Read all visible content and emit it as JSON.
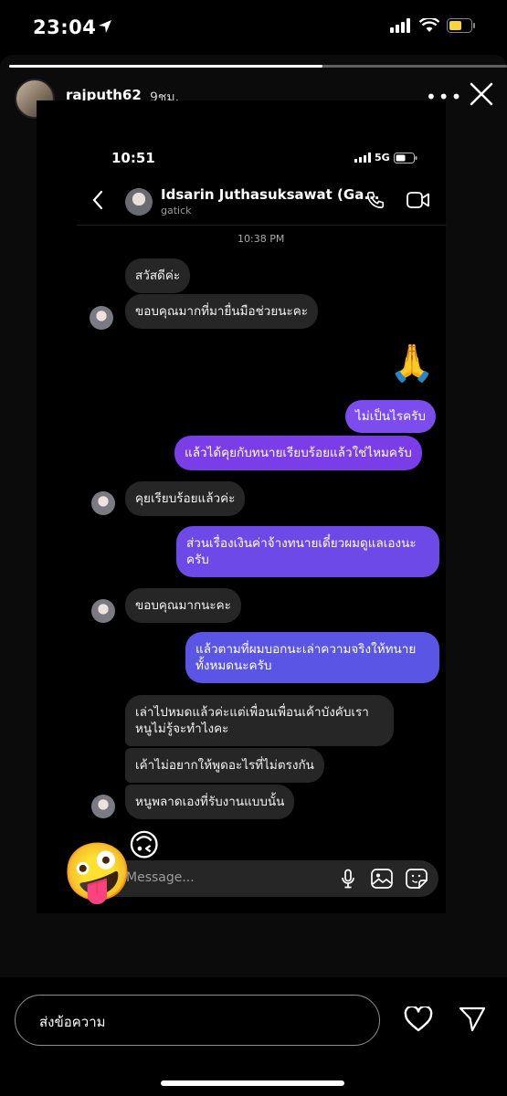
{
  "status_bar": {
    "time": "23:04"
  },
  "story": {
    "progress": 0.63,
    "username": "rajputh62",
    "time_ago": "9ชม."
  },
  "embedded": {
    "time": "10:51",
    "network": "5G",
    "chat_name": "Idsarin Juthasuksawat (Ga...",
    "chat_handle": "gatick",
    "date_label": "10:38 PM",
    "messages": [
      {
        "text": "สวัสดีค่ะ",
        "side": "received"
      },
      {
        "text": "ขอบคุณมากที่มายื่นมือช่วยนะคะ",
        "side": "received"
      },
      {
        "text": "🙏",
        "side": "sent"
      },
      {
        "text": "ไม่เป็นไรครับ",
        "side": "sent"
      },
      {
        "text": "แล้วได้คุยกับทนายเรียบร้อยแล้วใช่ไหมครับ",
        "side": "sent"
      },
      {
        "text": "คุยเรียบร้อยแล้วค่ะ",
        "side": "received"
      },
      {
        "line1": "ส่วนเรื่องเงินค่าจ้างทนายเดี๋ยวผมดูแลเองนะ",
        "line2": "ครับ",
        "side": "sent"
      },
      {
        "text": "ขอบคุณมากนะคะ",
        "side": "received"
      },
      {
        "line1": "แล้วตามที่ผมบอกนะเล่าความจริงให้ทนาย",
        "line2": "ทั้งหมดนะครับ",
        "side": "sent"
      },
      {
        "line1": "เล่าไปหมดแล้วค่ะแต่เพื่อนเพื่อนเค้าบังคับเรา",
        "line2": "หนูไม่รู้จะทำไงคะ",
        "side": "received"
      },
      {
        "text": "เค้าไม่อยากให้พูดอะไรที่ไม่ตรงกัน",
        "side": "received"
      },
      {
        "text": "หนูพลาดเองที่รับงานแบบนั้น",
        "side": "received"
      },
      {
        "text": "🙃",
        "side": "received"
      }
    ],
    "message_placeholder": "Message..."
  },
  "sticker_emoji": "🤪",
  "reply": {
    "placeholder": "ส่งข้อความ"
  },
  "colors": {
    "sent_top": "#8a47f0",
    "sent_bottom": "#5a5be8",
    "received": "#262626"
  }
}
